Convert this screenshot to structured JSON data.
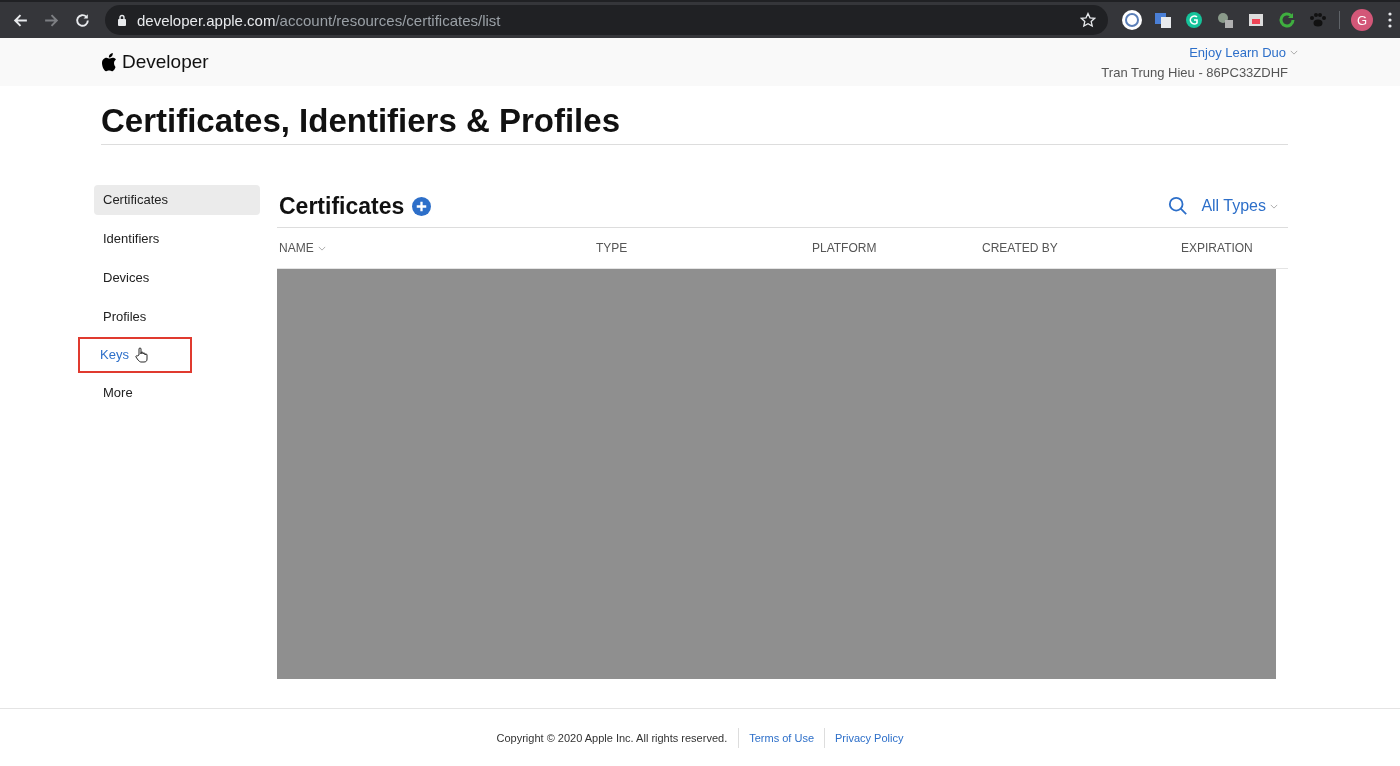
{
  "browser": {
    "url_host": "developer.apple.com",
    "url_path": "/account/resources/certificates/list",
    "avatar": "G"
  },
  "header": {
    "brand": "Developer",
    "account": "Enjoy Learn Duo",
    "user": "Tran Trung Hieu - 86PC33ZDHF"
  },
  "page_title": "Certificates, Identifiers & Profiles",
  "sidebar": {
    "items": [
      {
        "label": "Certificates",
        "selected": true,
        "highlighted": false
      },
      {
        "label": "Identifiers",
        "selected": false,
        "highlighted": false
      },
      {
        "label": "Devices",
        "selected": false,
        "highlighted": false
      },
      {
        "label": "Profiles",
        "selected": false,
        "highlighted": false
      },
      {
        "label": "Keys",
        "selected": false,
        "highlighted": true
      },
      {
        "label": "More",
        "selected": false,
        "highlighted": false
      }
    ]
  },
  "section": {
    "title": "Certificates",
    "filter": "All Types"
  },
  "table": {
    "columns": [
      {
        "label": "NAME",
        "sortable": true
      },
      {
        "label": "TYPE",
        "sortable": false
      },
      {
        "label": "PLATFORM",
        "sortable": false
      },
      {
        "label": "CREATED BY",
        "sortable": false
      },
      {
        "label": "EXPIRATION",
        "sortable": false
      }
    ]
  },
  "footer": {
    "copyright": "Copyright © 2020 Apple Inc. All rights reserved.",
    "links": [
      "Terms of Use",
      "Privacy Policy"
    ]
  }
}
